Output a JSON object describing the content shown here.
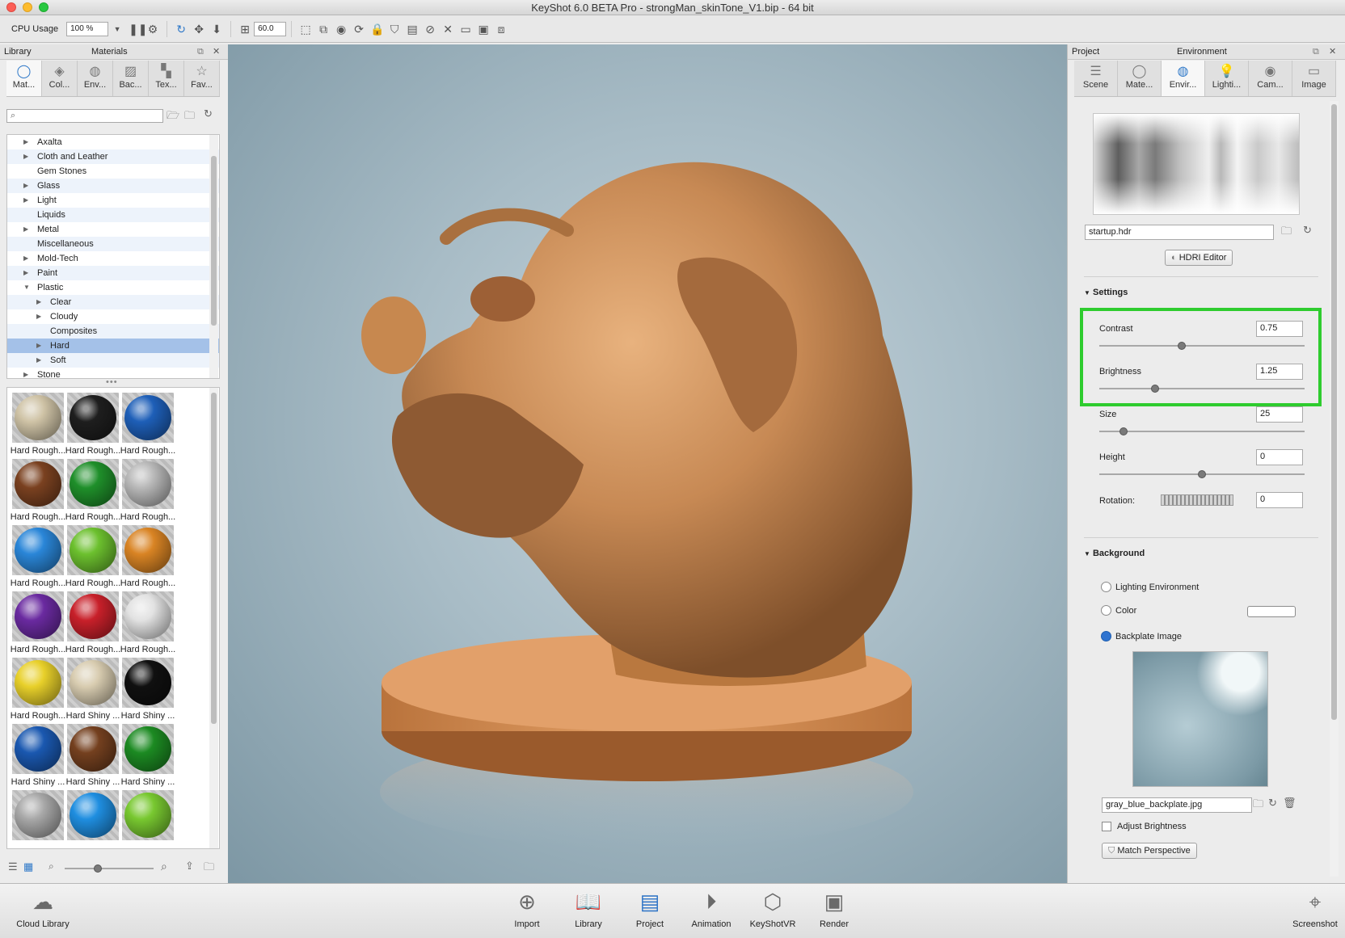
{
  "window": {
    "title": "KeyShot 6.0 BETA Pro   -  strongMan_skinTone_V1.bip  - 64 bit"
  },
  "toolbar": {
    "cpu_label": "CPU Usage",
    "cpu_value": "100 %",
    "fov_value": "60.0"
  },
  "library": {
    "header_left": "Library",
    "header_title": "Materials",
    "tabs": [
      "Mat...",
      "Col...",
      "Env...",
      "Bac...",
      "Tex...",
      "Fav..."
    ],
    "search_placeholder": "",
    "tree": [
      {
        "label": "Axalta",
        "level": 1,
        "arrow": "right"
      },
      {
        "label": "Cloth and Leather",
        "level": 1,
        "arrow": "right"
      },
      {
        "label": "Gem Stones",
        "level": 1,
        "arrow": ""
      },
      {
        "label": "Glass",
        "level": 1,
        "arrow": "right"
      },
      {
        "label": "Light",
        "level": 1,
        "arrow": "right"
      },
      {
        "label": "Liquids",
        "level": 1,
        "arrow": ""
      },
      {
        "label": "Metal",
        "level": 1,
        "arrow": "right"
      },
      {
        "label": "Miscellaneous",
        "level": 1,
        "arrow": ""
      },
      {
        "label": "Mold-Tech",
        "level": 1,
        "arrow": "right"
      },
      {
        "label": "Paint",
        "level": 1,
        "arrow": "right"
      },
      {
        "label": "Plastic",
        "level": 1,
        "arrow": "down"
      },
      {
        "label": "Clear",
        "level": 2,
        "arrow": "right"
      },
      {
        "label": "Cloudy",
        "level": 2,
        "arrow": "right"
      },
      {
        "label": "Composites",
        "level": 2,
        "arrow": ""
      },
      {
        "label": "Hard",
        "level": 2,
        "arrow": "right",
        "selected": true
      },
      {
        "label": "Soft",
        "level": 2,
        "arrow": "right"
      },
      {
        "label": "Stone",
        "level": 1,
        "arrow": "right"
      }
    ],
    "materials": [
      {
        "label": "Hard Rough...",
        "color": "#cfc3a6"
      },
      {
        "label": "Hard Rough...",
        "color": "#1e1e1e"
      },
      {
        "label": "Hard Rough...",
        "color": "#1e5fb8"
      },
      {
        "label": "Hard Rough...",
        "color": "#7a4120"
      },
      {
        "label": "Hard Rough...",
        "color": "#1f8f2a"
      },
      {
        "label": "Hard Rough...",
        "color": "#b8b8b8"
      },
      {
        "label": "Hard Rough...",
        "color": "#2a86d8"
      },
      {
        "label": "Hard Rough...",
        "color": "#6cc02e"
      },
      {
        "label": "Hard Rough...",
        "color": "#d98424"
      },
      {
        "label": "Hard Rough...",
        "color": "#6a2aa0"
      },
      {
        "label": "Hard Rough...",
        "color": "#c8202a"
      },
      {
        "label": "Hard Rough...",
        "color": "#e2e2e2"
      },
      {
        "label": "Hard Rough...",
        "color": "#e8d02a"
      },
      {
        "label": "Hard Shiny ...",
        "color": "#d8ccb0"
      },
      {
        "label": "Hard Shiny ...",
        "color": "#101010"
      },
      {
        "label": "Hard Shiny ...",
        "color": "#1a58b0"
      },
      {
        "label": "Hard Shiny ...",
        "color": "#74401f"
      },
      {
        "label": "Hard Shiny ...",
        "color": "#1c8a22"
      },
      {
        "label": "",
        "color": "#a8a8a8"
      },
      {
        "label": "",
        "color": "#1f8ee0"
      },
      {
        "label": "",
        "color": "#78c830"
      }
    ]
  },
  "project": {
    "header_left": "Project",
    "header_title": "Environment",
    "tabs": [
      "Scene",
      "Mate...",
      "Envir...",
      "Lighti...",
      "Cam...",
      "Image"
    ],
    "hdr_file": "startup.hdr",
    "hdri_editor": "HDRI Editor",
    "settings_title": "Settings",
    "contrast_label": "Contrast",
    "contrast_value": "0.75",
    "contrast_level": 0.4,
    "brightness_label": "Brightness",
    "brightness_value": "1.25",
    "brightness_level": 0.27,
    "size_label": "Size",
    "size_value": "25",
    "size_level": 0.12,
    "height_label": "Height",
    "height_value": "0",
    "height_level": 0.5,
    "rotation_label": "Rotation:",
    "rotation_value": "0",
    "background_title": "Background",
    "bg_option_1": "Lighting Environment",
    "bg_option_2": "Color",
    "bg_option_3": "Backplate Image",
    "backplate_file": "gray_blue_backplate.jpg",
    "adjust_brightness": "Adjust Brightness",
    "match_perspective": "Match Perspective"
  },
  "bottom": {
    "cloud_library": "Cloud Library",
    "import": "Import",
    "library": "Library",
    "project": "Project",
    "animation": "Animation",
    "keyshotvr": "KeyShotVR",
    "render": "Render",
    "screenshot": "Screenshot"
  },
  "colors": {
    "accent": "#2e78c8",
    "highlight": "#2ecc2e",
    "selection": "#a4c1e8"
  }
}
